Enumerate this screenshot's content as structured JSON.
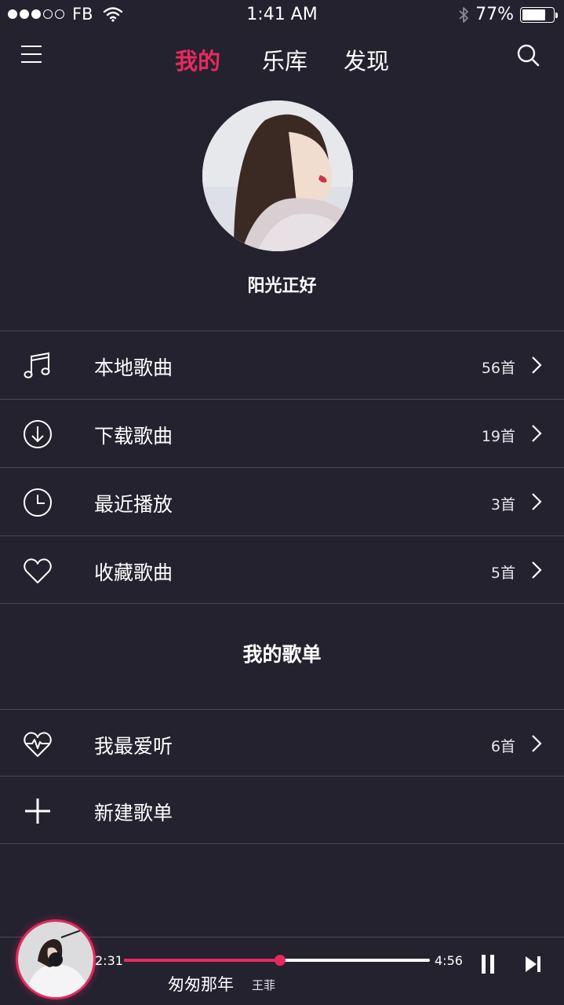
{
  "status_bar": {
    "carrier": "FB",
    "time": "1:41 AM",
    "battery_percent": "77%",
    "battery_level": 0.77,
    "signal_bars_filled": 3,
    "signal_bars_total": 5
  },
  "header": {
    "tabs": [
      {
        "label": "我的",
        "active": true
      },
      {
        "label": "乐库",
        "active": false
      },
      {
        "label": "发现",
        "active": false
      }
    ],
    "menu_icon": "hamburger-icon",
    "search_icon": "search-icon"
  },
  "profile": {
    "username": "阳光正好"
  },
  "library": {
    "items": [
      {
        "label": "本地歌曲",
        "count": "56首",
        "icon": "music-note-icon"
      },
      {
        "label": "下载歌曲",
        "count": "19首",
        "icon": "download-icon"
      },
      {
        "label": "最近播放",
        "count": "3首",
        "icon": "clock-icon"
      },
      {
        "label": "收藏歌曲",
        "count": "5首",
        "icon": "heart-icon"
      }
    ]
  },
  "playlists": {
    "title": "我的歌单",
    "items": [
      {
        "label": "我最爱听",
        "count": "6首",
        "icon": "heart-pulse-icon"
      },
      {
        "label": "新建歌单",
        "icon": "plus-icon"
      }
    ]
  },
  "player": {
    "elapsed": "2:31",
    "duration": "4:56",
    "progress": 0.51,
    "song_title": "匆匆那年",
    "artist": "王菲",
    "accent_color": "#e8295e"
  },
  "colors": {
    "background": "#24222f",
    "accent": "#e8295e",
    "divider": "#4a4858",
    "text": "#ffffff"
  }
}
